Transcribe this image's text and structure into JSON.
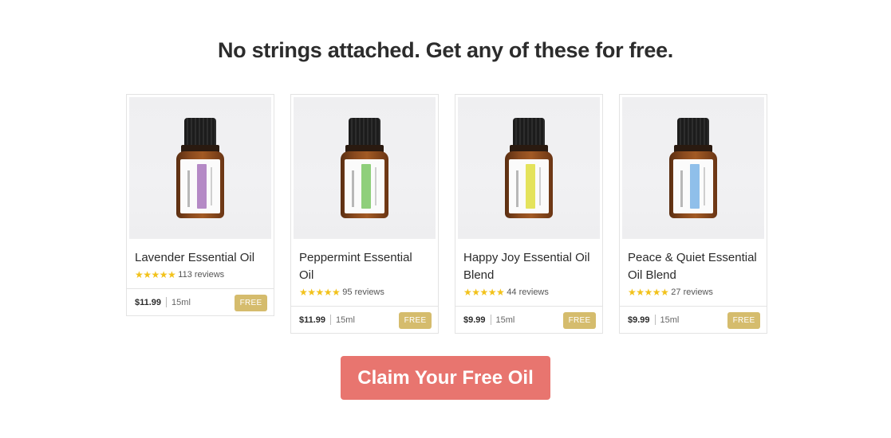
{
  "headline": "No strings attached. Get any of these for free.",
  "products": [
    {
      "name": "Lavender Essential Oil",
      "stars": "★★★★★",
      "rating": 5,
      "reviews": "113 reviews",
      "price": "$11.99",
      "size": "15ml",
      "badge": "FREE",
      "label_color": "#b58ac6"
    },
    {
      "name": "Peppermint Essential Oil",
      "stars": "★★★★★",
      "rating": 5,
      "reviews": "95 reviews",
      "price": "$11.99",
      "size": "15ml",
      "badge": "FREE",
      "label_color": "#8fcf7b"
    },
    {
      "name": "Happy Joy Essential Oil Blend",
      "stars": "★★★★★",
      "rating": 5,
      "reviews": "44 reviews",
      "price": "$9.99",
      "size": "15ml",
      "badge": "FREE",
      "label_color": "#e4e35c"
    },
    {
      "name": "Peace & Quiet Essential Oil Blend",
      "stars": "★★★★★",
      "rating": 5,
      "reviews": "27 reviews",
      "price": "$9.99",
      "size": "15ml",
      "badge": "FREE",
      "label_color": "#8fbfea"
    }
  ],
  "cta": {
    "label": "Claim Your Free Oil",
    "color": "#e8756f"
  },
  "colors": {
    "free_badge": "#d5bc6d",
    "stars": "#f2c21b"
  }
}
